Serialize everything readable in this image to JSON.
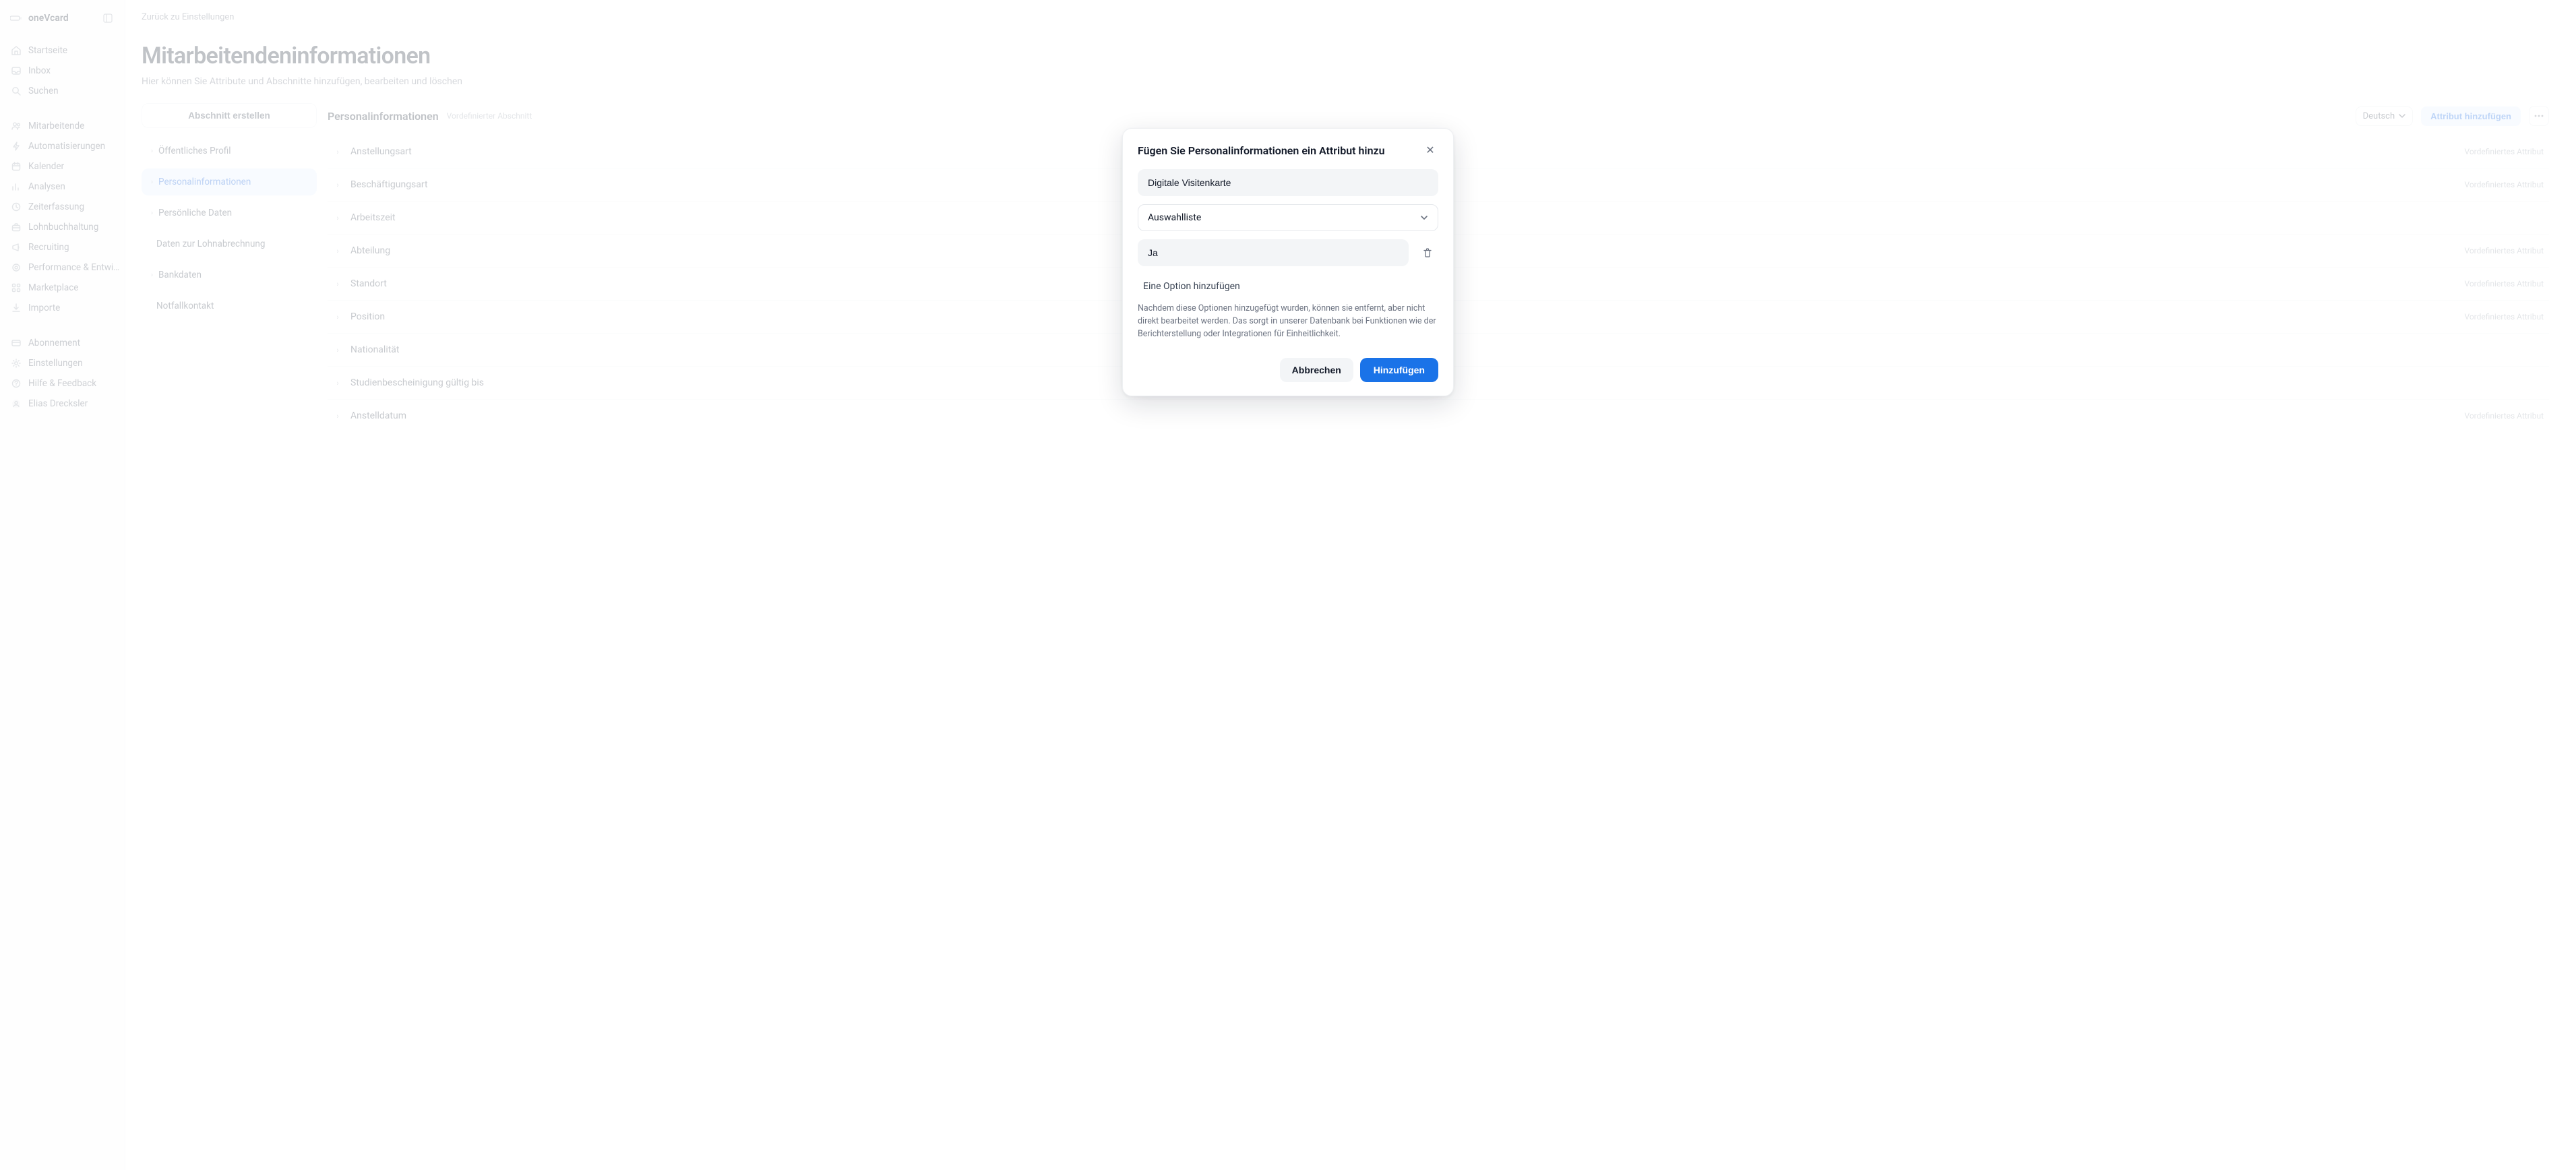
{
  "brand": {
    "name": "oneVcard"
  },
  "sidebar": {
    "primary": [
      {
        "label": "Startseite",
        "icon": "home"
      },
      {
        "label": "Inbox",
        "icon": "inbox"
      },
      {
        "label": "Suchen",
        "icon": "search"
      }
    ],
    "secondary": [
      {
        "label": "Mitarbeitende",
        "icon": "users"
      },
      {
        "label": "Automatisierungen",
        "icon": "bolt"
      },
      {
        "label": "Kalender",
        "icon": "calendar"
      },
      {
        "label": "Analysen",
        "icon": "chart"
      },
      {
        "label": "Zeiterfassung",
        "icon": "clock"
      },
      {
        "label": "Lohnbuchhaltung",
        "icon": "briefcase"
      },
      {
        "label": "Recruiting",
        "icon": "megaphone"
      },
      {
        "label": "Performance & Entwi…",
        "icon": "target"
      },
      {
        "label": "Marketplace",
        "icon": "grid"
      },
      {
        "label": "Importe",
        "icon": "download"
      }
    ],
    "footer": [
      {
        "label": "Abonnement",
        "icon": "card"
      },
      {
        "label": "Einstellungen",
        "icon": "gear"
      },
      {
        "label": "Hilfe & Feedback",
        "icon": "help"
      },
      {
        "label": "Elias Drecksler",
        "icon": "avatar"
      }
    ]
  },
  "breadcrumb": "Zurück zu Einstellungen",
  "page": {
    "title": "Mitarbeitendeninformationen",
    "subtitle": "Hier können Sie Attribute und Abschnitte hinzufügen, bearbeiten und löschen"
  },
  "sectionsPanel": {
    "createLabel": "Abschnitt erstellen",
    "items": [
      {
        "label": "Öffentliches Profil",
        "chev": true
      },
      {
        "label": "Personalinformationen",
        "chev": true,
        "active": true
      },
      {
        "label": "Persönliche Daten",
        "chev": true
      },
      {
        "label": "Daten zur Lohnabrechnung",
        "chev": false
      },
      {
        "label": "Bankdaten",
        "chev": true
      },
      {
        "label": "Notfallkontakt",
        "chev": false
      }
    ]
  },
  "attrsPanel": {
    "heading": "Personalinformationen",
    "tag": "Vordefinierter Abschnitt",
    "language": "Deutsch",
    "addButton": "Attribut hinzufügen",
    "predefLabel": "Vordefiniertes Attribut",
    "rows": [
      {
        "name": "Anstellungsart",
        "predef": true
      },
      {
        "name": "Beschäftigungsart",
        "predef": true
      },
      {
        "name": "Arbeitszeit",
        "predef": false
      },
      {
        "name": "Abteilung",
        "predef": true
      },
      {
        "name": "Standort",
        "predef": true
      },
      {
        "name": "Position",
        "predef": true
      },
      {
        "name": "Nationalität",
        "predef": false
      },
      {
        "name": "Studienbescheinigung gültig bis",
        "predef": false
      },
      {
        "name": "Anstelldatum",
        "predef": true
      }
    ]
  },
  "modal": {
    "title": "Fügen Sie Personalinformationen ein Attribut hinzu",
    "nameValue": "Digitale Visitenkarte",
    "typeValue": "Auswahlliste",
    "optionValue": "Ja",
    "addOption": "Eine Option hinzufügen",
    "help": "Nachdem diese Optionen hinzugefügt wurden, können sie entfernt, aber nicht direkt bearbeitet werden. Das sorgt in unserer Datenbank bei Funktionen wie der Berichterstellung oder Integrationen für Einheitlichkeit.",
    "cancel": "Abbrechen",
    "submit": "Hinzufügen"
  }
}
